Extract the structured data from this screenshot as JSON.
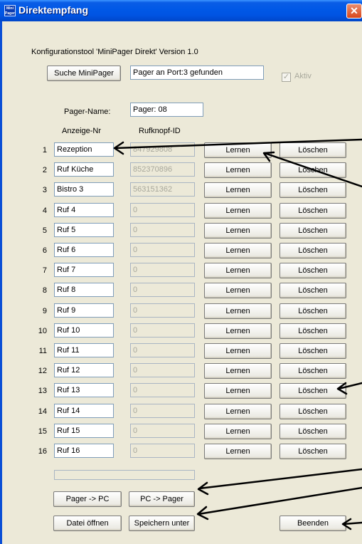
{
  "window": {
    "title": "Direktempfang",
    "icon_label": "Mini Pager"
  },
  "header": {
    "version_text": "Konfigurationstool 'MiniPager Direkt'  Version 1.0"
  },
  "search": {
    "button_label": "Suche MiniPager",
    "status_value": "Pager an Port:3 gefunden",
    "active_label": "Aktiv",
    "active_checked": true
  },
  "pager": {
    "name_label": "Pager-Name:",
    "name_value": "Pager: 08"
  },
  "columns": {
    "display_nr": "Anzeige-Nr",
    "button_id": "Rufknopf-ID"
  },
  "rows": [
    {
      "num": "1",
      "name": "Rezeption",
      "id": "847929808",
      "learn": "Lernen",
      "delete": "Löschen"
    },
    {
      "num": "2",
      "name": "Ruf Küche",
      "id": "852370896",
      "learn": "Lernen",
      "delete": "Löschen"
    },
    {
      "num": "3",
      "name": "Bistro 3",
      "id": "563151362",
      "learn": "Lernen",
      "delete": "Löschen"
    },
    {
      "num": "4",
      "name": "Ruf 4",
      "id": "0",
      "learn": "Lernen",
      "delete": "Löschen"
    },
    {
      "num": "5",
      "name": "Ruf 5",
      "id": "0",
      "learn": "Lernen",
      "delete": "Löschen"
    },
    {
      "num": "6",
      "name": "Ruf 6",
      "id": "0",
      "learn": "Lernen",
      "delete": "Löschen"
    },
    {
      "num": "7",
      "name": "Ruf 7",
      "id": "0",
      "learn": "Lernen",
      "delete": "Löschen"
    },
    {
      "num": "8",
      "name": "Ruf 8",
      "id": "0",
      "learn": "Lernen",
      "delete": "Löschen"
    },
    {
      "num": "9",
      "name": "Ruf 9",
      "id": "0",
      "learn": "Lernen",
      "delete": "Löschen"
    },
    {
      "num": "10",
      "name": "Ruf 10",
      "id": "0",
      "learn": "Lernen",
      "delete": "Löschen"
    },
    {
      "num": "11",
      "name": "Ruf 11",
      "id": "0",
      "learn": "Lernen",
      "delete": "Löschen"
    },
    {
      "num": "12",
      "name": "Ruf 12",
      "id": "0",
      "learn": "Lernen",
      "delete": "Löschen"
    },
    {
      "num": "13",
      "name": "Ruf 13",
      "id": "0",
      "learn": "Lernen",
      "delete": "Löschen"
    },
    {
      "num": "14",
      "name": "Ruf 14",
      "id": "0",
      "learn": "Lernen",
      "delete": "Löschen"
    },
    {
      "num": "15",
      "name": "Ruf 15",
      "id": "0",
      "learn": "Lernen",
      "delete": "Löschen"
    },
    {
      "num": "16",
      "name": "Ruf 16",
      "id": "0",
      "learn": "Lernen",
      "delete": "Löschen"
    }
  ],
  "bottom": {
    "pager_to_pc": "Pager -> PC",
    "pc_to_pager": "PC -> Pager",
    "open_file": "Datei öffnen",
    "save_as": "Speichern unter",
    "exit": "Beenden"
  }
}
